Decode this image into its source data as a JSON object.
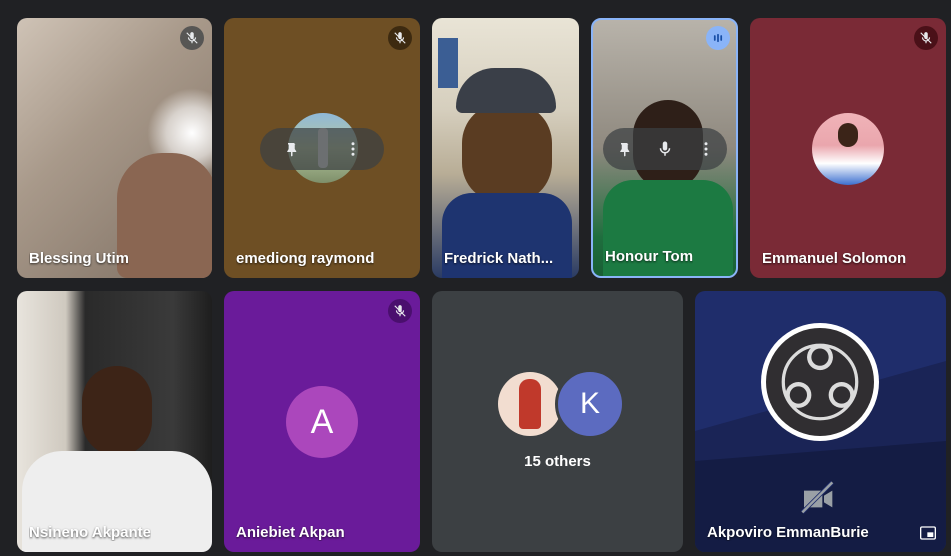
{
  "participants": [
    {
      "name": "Blessing Utim",
      "muted": true
    },
    {
      "name": "emediong raymond",
      "muted": true
    },
    {
      "name": "Fredrick Nath...",
      "muted": false
    },
    {
      "name": "Honour Tom",
      "speaking": true
    },
    {
      "name": "Emmanuel Solomon",
      "muted": true
    },
    {
      "name": "Nsineno Akpante",
      "muted": false
    },
    {
      "name": "Aniebiet Akpan",
      "muted": true,
      "avatar_letter": "A"
    },
    {
      "name": "Akpoviro EmmanBurie",
      "muted": false
    }
  ],
  "others_tile": {
    "avatar_letter": "K",
    "label": "15 others"
  },
  "colors": {
    "background": "#202124",
    "tile_purple": "#6a1b9a",
    "avatar_purple": "#ab47bc",
    "avatar_blue": "#5c6bc0",
    "speaking_border": "#8ab4f8",
    "obs_tile_blue": "#1f2d6b"
  },
  "icons": [
    "mic-off-icon",
    "pin-icon",
    "mic-icon",
    "more-vert-icon",
    "audio-bars-icon",
    "video-off-icon",
    "picture-in-picture-icon",
    "obs-logo"
  ]
}
